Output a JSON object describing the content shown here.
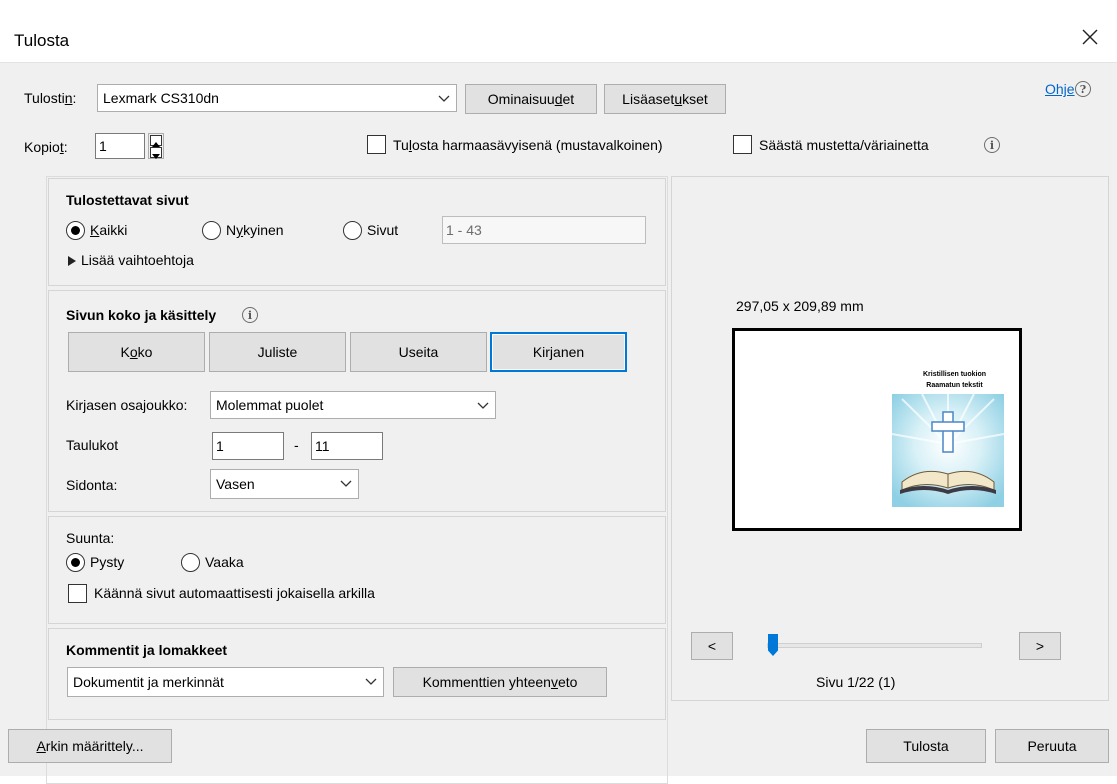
{
  "window": {
    "title": "Tulosta"
  },
  "printer": {
    "label_pre": "Tulosti",
    "label_mn": "n",
    "label_post": ":",
    "selected": "Lexmark CS310dn",
    "properties_pre": "Ominaisuu",
    "properties_mn": "d",
    "properties_post": "et",
    "advanced_pre": "Lisäaset",
    "advanced_mn": "u",
    "advanced_post": "kset",
    "help_label": "Ohje"
  },
  "copies": {
    "label_pre": "Kopio",
    "label_mn": "t",
    "label_post": ":",
    "value": "1",
    "grayscale_pre": "Tu",
    "grayscale_mn": "l",
    "grayscale_post": "osta harmaasävyisenä (mustavalkoinen)",
    "grayscale_checked": false,
    "save_ink_label": "Säästä mustetta/väriainetta",
    "save_ink_checked": false
  },
  "pages_to_print": {
    "title": "Tulostettavat sivut",
    "all_mn": "K",
    "all_post": "aikki",
    "current_pre": "N",
    "current_mn": "y",
    "current_post": "kyinen",
    "pages_label": "Sivut",
    "pages_placeholder": "1 - 43",
    "selected": "all",
    "more_options": "Lisää vaihtoehtoja"
  },
  "page_sizing": {
    "title": "Sivun koko ja käsittely",
    "buttons": [
      {
        "pre": "K",
        "mn": "o",
        "post": "ko"
      },
      {
        "pre": "",
        "mn": "",
        "post": "Juliste"
      },
      {
        "pre": "",
        "mn": "",
        "post": "Useita"
      },
      {
        "pre": "",
        "mn": "",
        "post": "Kirjanen"
      }
    ],
    "active": "Kirjanen",
    "subset_label": "Kirjasen osajoukko:",
    "subset_value": "Molemmat puolet",
    "sheets_label": "Taulukot",
    "sheets_from": "1",
    "sheets_dash": "-",
    "sheets_to": "11",
    "binding_label": "Sidonta:",
    "binding_value": "Vasen"
  },
  "orientation": {
    "title": "Suunta:",
    "portrait": "Pysty",
    "landscape": "Vaaka",
    "selected": "portrait",
    "autorotate_pre": "Käännä sivut automaattisesti ",
    "autorotate_mn": "j",
    "autorotate_post": "okaisella arkilla",
    "autorotate_checked": false
  },
  "comments": {
    "title": "Kommentit ja lomakkeet",
    "selected": "Dokumentit ja merkinnät",
    "summary_pre": "Kommenttien yhteen",
    "summary_mn": "v",
    "summary_post": "eto"
  },
  "preview": {
    "dimensions": "297,05 x 209,89 mm",
    "doc_title_line1": "Kristillisen tuokion",
    "doc_title_line2": "Raamatun tekstit",
    "prev_button": "<",
    "next_button": ">",
    "page_indicator": "Sivu 1/22 (1)",
    "slider_position": 0
  },
  "footer": {
    "page_setup_mn": "A",
    "page_setup_post": "rkin määrittely...",
    "print_button": "Tulosta",
    "cancel_button": "Peruuta"
  },
  "colors": {
    "accent": "#0078d7",
    "link": "#0066cc",
    "dialog_bg": "#f0f0f0"
  },
  "icons": [
    "close-icon",
    "chevron-down-icon",
    "help-icon",
    "info-icon",
    "spin-up-icon",
    "spin-down-icon",
    "expand-triangle-icon",
    "bible-cross-image"
  ]
}
